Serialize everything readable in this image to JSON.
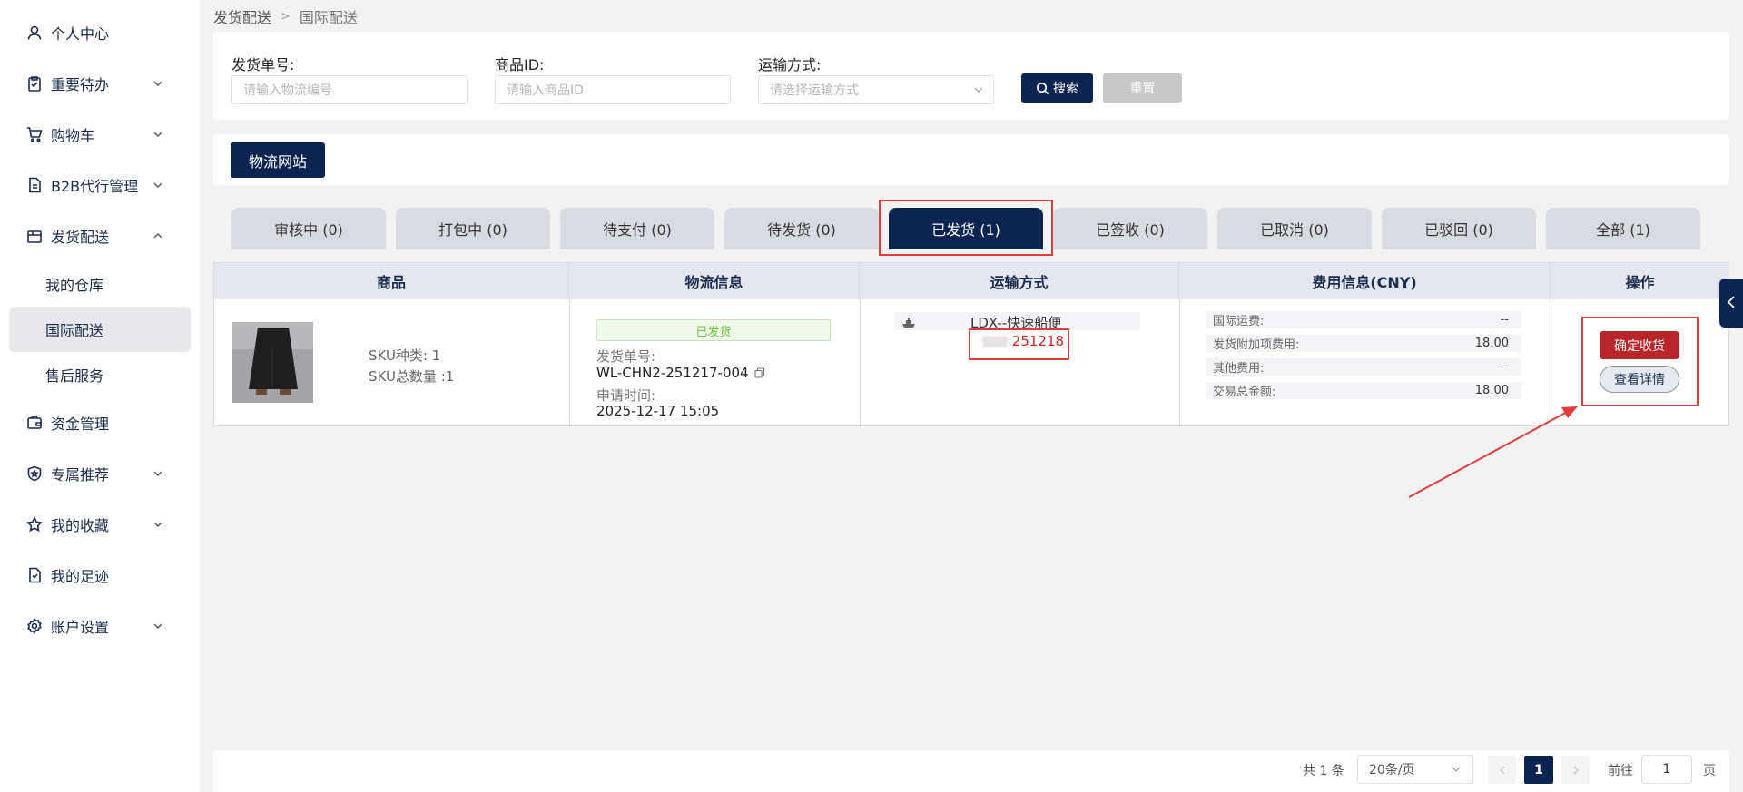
{
  "sidebar": {
    "items": [
      {
        "label": "个人中心",
        "icon": "user-icon"
      },
      {
        "label": "重要待办",
        "icon": "clipboard-check-icon"
      },
      {
        "label": "购物车",
        "icon": "cart-icon"
      },
      {
        "label": "B2B代行管理",
        "icon": "document-icon"
      },
      {
        "label": "发货配送",
        "icon": "box-icon"
      },
      {
        "label": "资金管理",
        "icon": "wallet-icon"
      },
      {
        "label": "专属推荐",
        "icon": "shield-star-icon"
      },
      {
        "label": "我的收藏",
        "icon": "star-icon"
      },
      {
        "label": "我的足迹",
        "icon": "footprint-icon"
      },
      {
        "label": "账户设置",
        "icon": "gear-icon"
      }
    ],
    "sub_items": [
      {
        "label": "我的仓库"
      },
      {
        "label": "国际配送"
      },
      {
        "label": "售后服务"
      }
    ]
  },
  "breadcrumb": {
    "parent": "发货配送",
    "current": "国际配送"
  },
  "filters": {
    "shipment_no_label": "发货单号:",
    "shipment_no_placeholder": "请输入物流编号",
    "product_id_label": "商品ID:",
    "product_id_placeholder": "请输入商品ID",
    "transport_label": "运输方式:",
    "transport_placeholder": "请选择运输方式",
    "search_label": "搜索",
    "reset_label": "重置"
  },
  "logistics_site_label": "物流网站",
  "tabs": [
    {
      "label": "审核中 (0)"
    },
    {
      "label": "打包中 (0)"
    },
    {
      "label": "待支付 (0)"
    },
    {
      "label": "待发货 (0)"
    },
    {
      "label": "已发货 (1)"
    },
    {
      "label": "已签收 (0)"
    },
    {
      "label": "已取消 (0)"
    },
    {
      "label": "已驳回 (0)"
    },
    {
      "label": "全部 (1)"
    }
  ],
  "table": {
    "headers": {
      "product": "商品",
      "logistics": "物流信息",
      "transport": "运输方式",
      "fees": "费用信息(CNY)",
      "actions": "操作"
    },
    "row": {
      "sku_types": "SKU种类: 1",
      "sku_total": "SKU总数量 :1",
      "status": "已发货",
      "shipment_no_label": "发货单号:",
      "shipment_no": "WL-CHN2-251217-004",
      "apply_time_label": "申请时间:",
      "apply_time": "2025-12-17 15:05",
      "transport_method": "LDX--快速船便",
      "tracking_no": "251218",
      "fees": [
        {
          "label": "国际运费:",
          "value": "--"
        },
        {
          "label": "发货附加项费用:",
          "value": "18.00"
        },
        {
          "label": "其他费用:",
          "value": "--"
        },
        {
          "label": "交易总金额:",
          "value": "18.00"
        }
      ],
      "confirm_label": "确定收货",
      "detail_label": "查看详情"
    }
  },
  "pagination": {
    "total": "共 1 条",
    "page_size": "20条/页",
    "current_page": "1",
    "goto_label": "前往",
    "goto_value": "1",
    "page_unit": "页"
  },
  "colors": {
    "primary": "#0c2451",
    "danger": "#b8262b",
    "highlight": "#e03c3c",
    "status_bg": "#f0f9eb",
    "status_text": "#67c23a"
  }
}
